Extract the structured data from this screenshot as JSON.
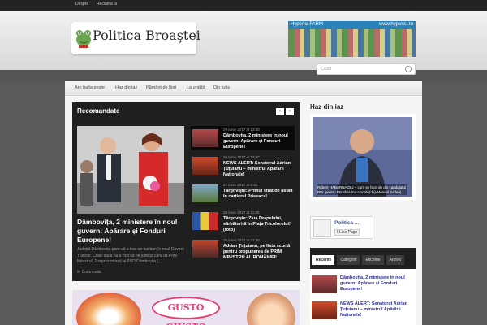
{
  "topbar": {
    "links": [
      "Despre",
      "Reclama la"
    ]
  },
  "header": {
    "logo_text": "Politica Broaştei",
    "banner": {
      "title": "Hyperici FARM",
      "url": "www.hyperici.ro"
    },
    "search_placeholder": "Caută"
  },
  "nav": {
    "items": [
      "Are balta pește",
      "Haz din iaz",
      "Pământ de flori",
      "La undiță",
      "Din tufiș"
    ]
  },
  "recommended": {
    "title": "Recomandate",
    "prev_icon": "chevron-left-icon",
    "next_icon": "chevron-right-icon",
    "featured": {
      "title": "Dâmbovița, 2 ministere în noul guvern: Apărare și Fonduri Europene!",
      "excerpt": "Județul Dâmbovița pare că a tras un loz bun în noul Guvern Tudose. Chiar dacă nu a fost să fie județul care dă Prim Ministrul, 2 reprezentanți ai PSD Dâmbovița [...]",
      "comments": "Comments"
    },
    "items": [
      {
        "date": "29 Iunie 2017 at 13:45",
        "title": "Dâmbovița, 2 ministere în noul guvern: Apărare și Fonduri Europene!"
      },
      {
        "date": "29 Iunie 2017 at 13:40",
        "title": "NEWS ALERT: Senatorul Adrian Țuțuianu – ministrul Apărării Naționale!"
      },
      {
        "date": "27 Iunie 2017 at 9:41",
        "title": "Târgoviște: Primul strat de asfalt în cartierul Priseaca!"
      },
      {
        "date": "26 Iunie 2017 at 11:05",
        "title": "Târgoviște: Ziua Drapelului, sărbătorită în Piața Tricolorului! (foto)"
      },
      {
        "date": "25 Iunie 2017 at 21:35",
        "title": "Adrian Țuțuianu, pe lista scurtă pentru propunerea de PRIM MINISTRU AL ROMÂNIEI!"
      }
    ]
  },
  "sidebar": {
    "heading": "Haz din iaz",
    "video_caption": "Robert HABARNAGIU – cum se face de din candidatul PNL pentru Primăria mu-ciorpilo(de)-Moreni! (video)",
    "fb": {
      "name": "Politica ...",
      "like": "Like Page"
    },
    "tabs": [
      "Recente",
      "Categorii",
      "Etichete",
      "Arhiva"
    ],
    "recent": [
      "Dâmbovița, 2 ministere în noul guvern: Apărare și Fonduri Europene!",
      "NEWS ALERT: Senatorul Adrian Țuțuianu – ministrul Apărării Naționale!"
    ]
  },
  "ad": {
    "text": "GUSTO GIUSTO"
  },
  "colors": {
    "topbar": "#232323",
    "panel": "#1f1f1f",
    "link": "#2d2da0",
    "fb": "#3b5998"
  }
}
